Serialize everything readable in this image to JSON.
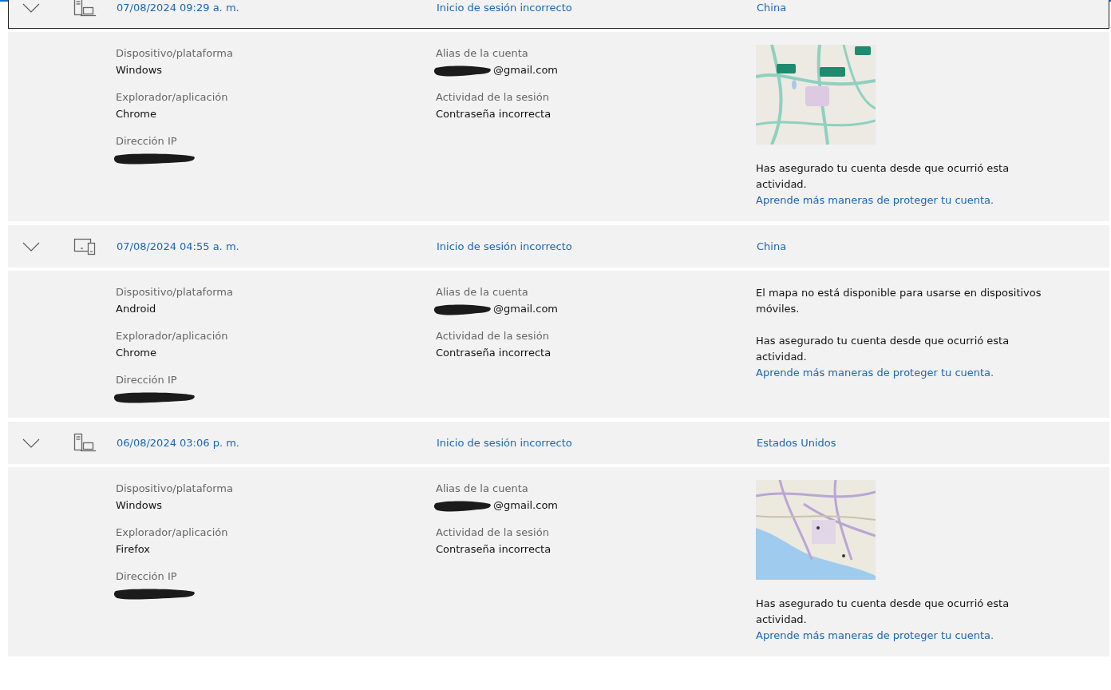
{
  "events": [
    {
      "expanded": true,
      "focused": true,
      "kind": "desktop",
      "date": "07/08/2024 09:29 a. m.",
      "activity": "Inicio de sesión incorrecto",
      "location": "China",
      "left_fields": [
        {
          "label": "Dispositivo/plataforma",
          "value": "Windows"
        },
        {
          "label": "Explorador/aplicación",
          "value": "Chrome"
        },
        {
          "label": "Dirección IP",
          "redacted": true
        }
      ],
      "middle_fields": [
        {
          "label": "Alias de la cuenta",
          "value": "@gmail.com",
          "redacted": true
        },
        {
          "label": "Actividad de la sesión",
          "value": "Contraseña incorrecta"
        }
      ],
      "map": {
        "kind": "picture"
      },
      "notice": "Has asegurado tu cuenta desde que ocurrió esta actividad.",
      "link": "Aprende más maneras de proteger tu cuenta."
    },
    {
      "expanded": true,
      "focused": false,
      "kind": "mobile",
      "date": "07/08/2024 04:55 a. m.",
      "activity": "Inicio de sesión incorrecto",
      "location": "China",
      "left_fields": [
        {
          "label": "Dispositivo/plataforma",
          "value": "Android"
        },
        {
          "label": "Explorador/aplicación",
          "value": "Chrome"
        },
        {
          "label": "Dirección IP",
          "redacted": true
        }
      ],
      "middle_fields": [
        {
          "label": "Alias de la cuenta",
          "value": "@gmail.com",
          "redacted": true
        },
        {
          "label": "Actividad de la sesión",
          "value": "Contraseña incorrecta"
        }
      ],
      "map_message": "El mapa no está disponible para usarse en dispositivos móviles.",
      "notice": "Has asegurado tu cuenta desde que ocurrió esta actividad.",
      "link": "Aprende más maneras de proteger tu cuenta."
    },
    {
      "expanded": true,
      "focused": false,
      "kind": "desktop",
      "date": "06/08/2024 03:06 p. m.",
      "activity": "Inicio de sesión incorrecto",
      "location": "Estados Unidos",
      "left_fields": [
        {
          "label": "Dispositivo/plataforma",
          "value": "Windows"
        },
        {
          "label": "Explorador/aplicación",
          "value": "Firefox"
        },
        {
          "label": "Dirección IP",
          "redacted": true
        }
      ],
      "middle_fields": [
        {
          "label": "Alias de la cuenta",
          "value": "@gmail.com",
          "redacted": true
        },
        {
          "label": "Actividad de la sesión",
          "value": "Contraseña incorrecta"
        }
      ],
      "map": {
        "kind": "picture"
      },
      "notice": "Has asegurado tu cuenta desde que ocurrió esta actividad.",
      "link": "Aprende más maneras de proteger tu cuenta."
    }
  ]
}
